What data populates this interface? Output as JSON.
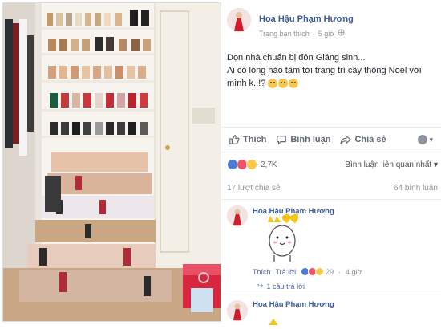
{
  "post": {
    "author": "Hoa Hậu Phạm Hương",
    "subtitle_relation": "Trang bạn thích",
    "separator": "·",
    "time_ago": "5 giờ",
    "text_line1": "Dọn nhà chuẩn bị đón Giáng sinh...",
    "text_line2": "Ai có lòng hảo tâm tới trang trí cây thông Noel với mình k..!?"
  },
  "actions": {
    "like": "Thích",
    "comment": "Bình luận",
    "share": "Chia sẻ"
  },
  "reactions": {
    "count": "2,7K",
    "sort_label": "Bình luận liên quan nhất",
    "sort_arrow": "▾"
  },
  "stats": {
    "shares": "17 lượt chia sẻ",
    "comments": "64 bình luận"
  },
  "comment": {
    "author": "Hoa Hậu Phạm Hương",
    "like": "Thích",
    "reply": "Trả lời",
    "reaction_count": "29",
    "time": "4 giờ",
    "replies": "1 câu trả lời",
    "reply_arrow": "↪"
  },
  "comment2": {
    "author": "Hoa Hậu Phạm Hương"
  },
  "colors": {
    "link": "#3b5998",
    "muted": "#90949c",
    "like_blue": "#4b7bd8",
    "love_red": "#f25268",
    "haha_yellow": "#f7c948"
  }
}
